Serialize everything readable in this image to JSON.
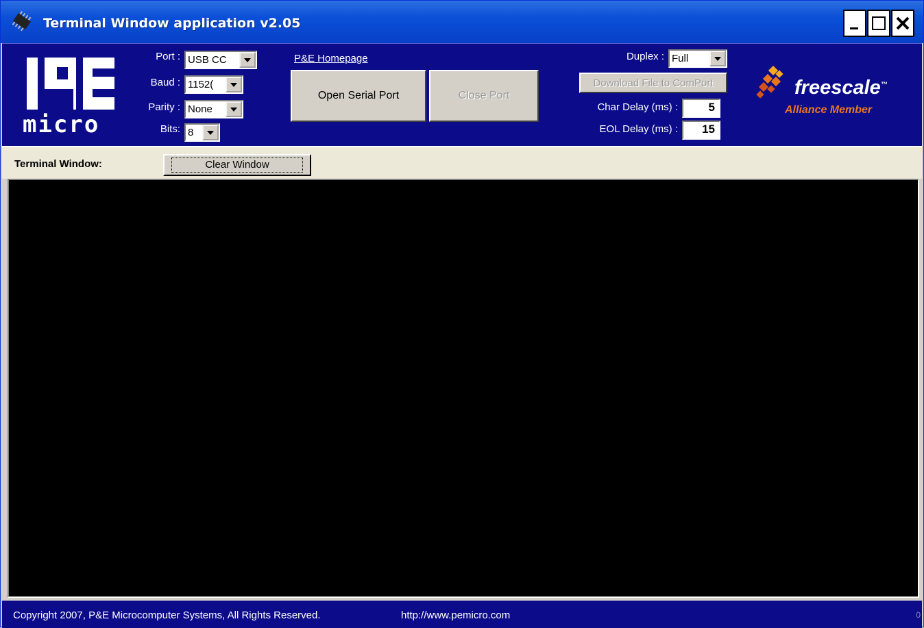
{
  "window": {
    "title": "Terminal Window application v2.05",
    "controls": {
      "minimize": "_",
      "maximize": "□",
      "close": "✕"
    }
  },
  "logo": {
    "brand": "micro"
  },
  "serial_settings": {
    "port_label": "Port :",
    "port_value": "USB CC",
    "baud_label": "Baud :",
    "baud_value": "1152(",
    "parity_label": "Parity :",
    "parity_value": "None",
    "bits_label": "Bits:",
    "bits_value": "8"
  },
  "links": {
    "homepage": "P&E Homepage"
  },
  "buttons": {
    "open_port": "Open Serial Port",
    "close_port": "Close Port",
    "download_file": "Download File to ComPort",
    "clear_window": "Clear Window"
  },
  "options": {
    "duplex_label": "Duplex :",
    "duplex_value": "Full",
    "char_delay_label": "Char Delay (ms) :",
    "char_delay_value": "5",
    "eol_delay_label": "EOL Delay (ms) :",
    "eol_delay_value": "15"
  },
  "partner_logo": {
    "name": "freescale",
    "tm": "™",
    "subtitle": "Alliance Member"
  },
  "terminal": {
    "label": "Terminal Window:"
  },
  "footer": {
    "copyright": "Copyright 2007, P&E Microcomputer Systems, All Rights Reserved.",
    "url": "http://www.pemicro.com",
    "counter": "0"
  },
  "colors": {
    "titlebar": "#0b4fd8",
    "header_bg": "#0c0c8a",
    "terminal_bg": "#000000",
    "freescale_orange": "#e8761e"
  }
}
